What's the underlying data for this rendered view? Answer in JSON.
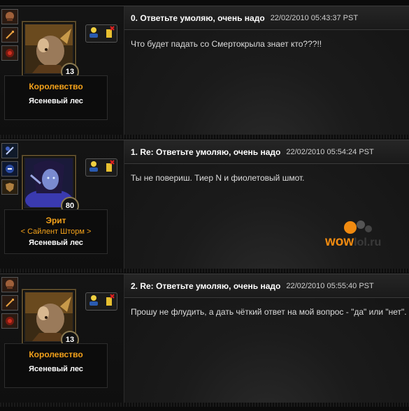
{
  "posts": [
    {
      "title": "0. Ответьте умоляю, очень надо",
      "date": "22/02/2010 05:43:37 PST",
      "body": "Что будет падать со Смертокрыла знает кто???!!",
      "character": {
        "name": "Королевство",
        "guild": "",
        "realm": "Ясеневый лес",
        "level": "13"
      }
    },
    {
      "title": "1. Re: Ответьте умоляю, очень надо",
      "date": "22/02/2010 05:54:24 PST",
      "body": "Ты не повериш. Тиер N и фиолетовый шмот.",
      "character": {
        "name": "Эрит",
        "guild": "< Сайлент Шторм >",
        "realm": "Ясеневый лес",
        "level": "80"
      }
    },
    {
      "title": "2. Re: Ответьте умоляю, очень надо",
      "date": "22/02/2010 05:55:40 PST",
      "body": "Прошу не флудить, а дать чёткий ответ на мой вопрос - \"да\" или \"нет\".",
      "character": {
        "name": "Королевство",
        "guild": "",
        "realm": "Ясеневый лес",
        "level": "13"
      }
    }
  ],
  "watermark": {
    "wow": "wow",
    "rest": "lol.ru"
  },
  "colors": {
    "accent": "#f4a21a",
    "header": "#262626",
    "bg": "#121212"
  }
}
